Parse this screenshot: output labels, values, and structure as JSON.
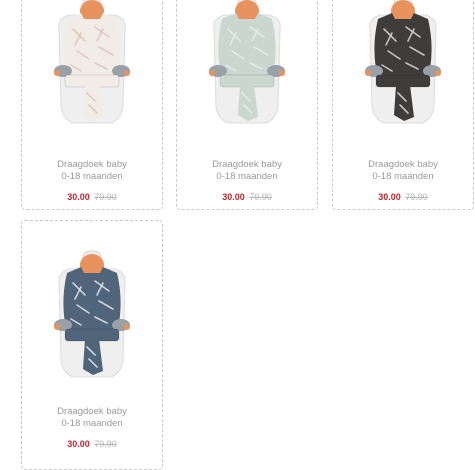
{
  "products": [
    {
      "title_line1": "Draagdoek baby",
      "title_line2": "0-18 maanden",
      "price_new": "30.00",
      "price_old": "79.90",
      "wrap_color": "#f2ece7",
      "pattern_color": "#d9c7bd",
      "icon": "baby-carrier-wrap-image"
    },
    {
      "title_line1": "Draagdoek baby",
      "title_line2": "0-18 maanden",
      "price_new": "30.00",
      "price_old": "79.90",
      "wrap_color": "#c9d7cf",
      "pattern_color": "#e8efea",
      "icon": "baby-carrier-wrap-image"
    },
    {
      "title_line1": "Draagdoek baby",
      "title_line2": "0-18 maanden",
      "price_new": "30.00",
      "price_old": "79.90",
      "wrap_color": "#3f3d3c",
      "pattern_color": "#d8d8d8",
      "icon": "baby-carrier-wrap-image"
    },
    {
      "title_line1": "Draagdoek baby",
      "title_line2": "0-18 maanden",
      "price_new": "30.00",
      "price_old": "79.90",
      "wrap_color": "#50657a",
      "pattern_color": "#dfe6ee",
      "icon": "baby-carrier-wrap-image"
    }
  ]
}
